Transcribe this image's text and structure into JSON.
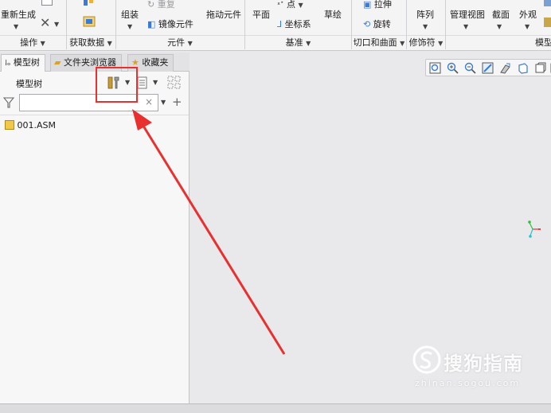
{
  "ribbon": {
    "row_top": {
      "regenerate": "重新生成",
      "redo": "重复",
      "assemble": "组装",
      "drag_components": "拖动元件",
      "plane": "平面",
      "point": "点",
      "sketch": "草绘",
      "extrude": "拉伸",
      "pattern": "阵列",
      "manage_views": "管理视图",
      "section": "截面",
      "appearance": "外观"
    },
    "row_mid": {
      "mirror_component": "镜像元件",
      "coordinate_system": "坐标系",
      "revolve": "旋转"
    },
    "groups": {
      "operations": "操作",
      "get_data": "获取数据",
      "component": "元件",
      "datum": "基准",
      "cut_and_surface": "切口和曲面",
      "modifiers": "修饰符",
      "model_display": "模型"
    }
  },
  "left_panel": {
    "tabs": [
      {
        "label": "模型树"
      },
      {
        "label": "文件夹浏览器"
      },
      {
        "label": "收藏夹"
      }
    ],
    "tree_title": "模型树",
    "search": {
      "value": "",
      "placeholder": ""
    },
    "tree_items": [
      {
        "label": "001.ASM"
      }
    ]
  },
  "annotation": {
    "highlight_color": "#e8312f",
    "arrow_color": "#e8312f"
  },
  "watermark": {
    "brand_text": "搜狗指南",
    "url": "zhinan.sogou.com"
  },
  "colors": {
    "ribbon_bg": "#f4f4f5",
    "panel_bg": "#f7f7f8",
    "canvas_bg": "#e9e9ec"
  }
}
